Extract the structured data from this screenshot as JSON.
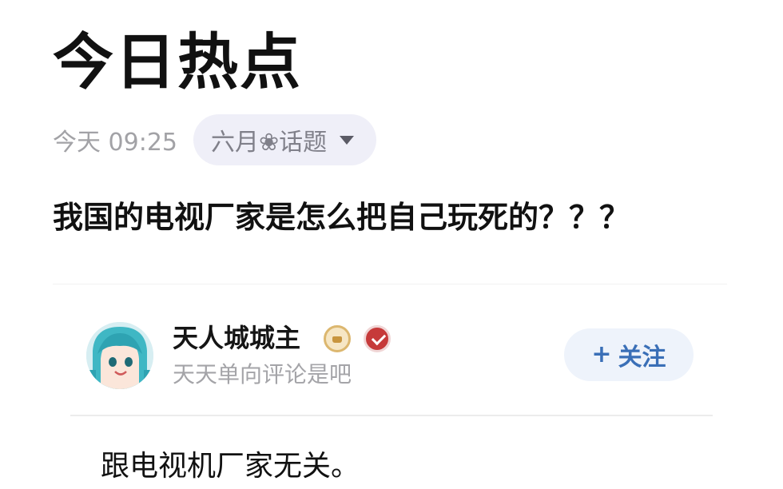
{
  "header": {
    "title": "今日热点"
  },
  "meta": {
    "timestamp": "今天 09:25",
    "topic": "六月❀话题",
    "topic_caret_icon": "caret-down-icon"
  },
  "question": {
    "text": "我国的电视厂家是怎么把自己玩死的？？？"
  },
  "answer": {
    "author": {
      "name": "天人城城主",
      "bio": "天天单向评论是吧",
      "avatar_icon": "avatar-image",
      "badges": [
        "level-badge-icon",
        "verified-badge-icon"
      ]
    },
    "follow": {
      "plus": "+",
      "label": "关注"
    },
    "text": "跟电视机厂家无关。"
  },
  "colors": {
    "accent": "#3a6fb7",
    "muted": "#a2a2a6",
    "pill_bg": "#efeff8",
    "follow_bg": "#eef3fb"
  }
}
